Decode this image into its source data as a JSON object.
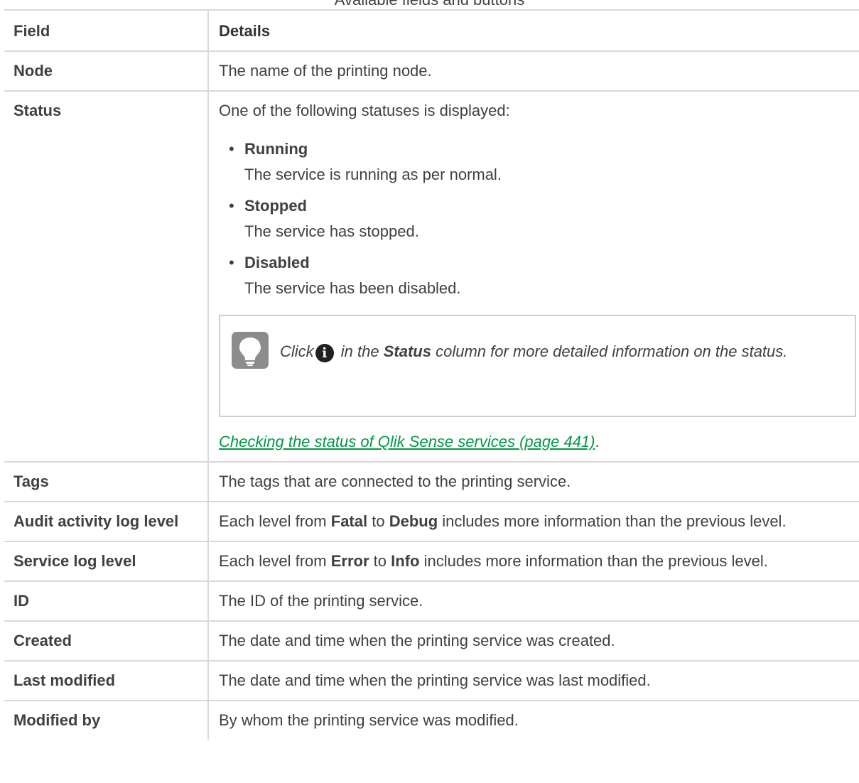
{
  "caption": "Available fields and buttons",
  "header": {
    "field": "Field",
    "details": "Details"
  },
  "rows": {
    "node": {
      "field": "Node",
      "details": "The name of the printing node."
    },
    "status": {
      "field": "Status",
      "intro": "One of the following statuses is displayed:",
      "items": [
        {
          "name": "Running",
          "desc": "The service is running as per normal."
        },
        {
          "name": "Stopped",
          "desc": "The service has stopped."
        },
        {
          "name": "Disabled",
          "desc": "The service has been disabled."
        }
      ],
      "tip": {
        "icon": "lightbulb-icon",
        "click": "Click",
        "info_glyph": "i",
        "in_the": "in the",
        "status_word": "Status",
        "rest": "column for more detailed information on the status."
      },
      "link_text": "Checking the status of Qlik Sense services (page 441)",
      "link_suffix": "."
    },
    "tags": {
      "field": "Tags",
      "details": "The tags that are connected to the printing service."
    },
    "audit": {
      "field": "Audit activity log level",
      "pre": "Each level from",
      "from": "Fatal",
      "to_word": "to",
      "to": "Debug",
      "post": "includes more information than the previous level."
    },
    "service_log": {
      "field": "Service log level",
      "pre": "Each level from",
      "from": "Error",
      "to_word": "to",
      "to": "Info",
      "post": "includes more information than the previous level."
    },
    "id": {
      "field": "ID",
      "details": "The ID of the printing service."
    },
    "created": {
      "field": "Created",
      "details": "The date and time when the printing service was created."
    },
    "last_modified": {
      "field": "Last modified",
      "details": "The date and time when the printing service was last modified."
    },
    "modified_by": {
      "field": "Modified by",
      "details": "By whom the printing service was modified."
    }
  },
  "colors": {
    "link": "#009845",
    "border": "#d9d9d9",
    "text": "#404040",
    "tip_icon_bg": "#8c8c8c"
  }
}
